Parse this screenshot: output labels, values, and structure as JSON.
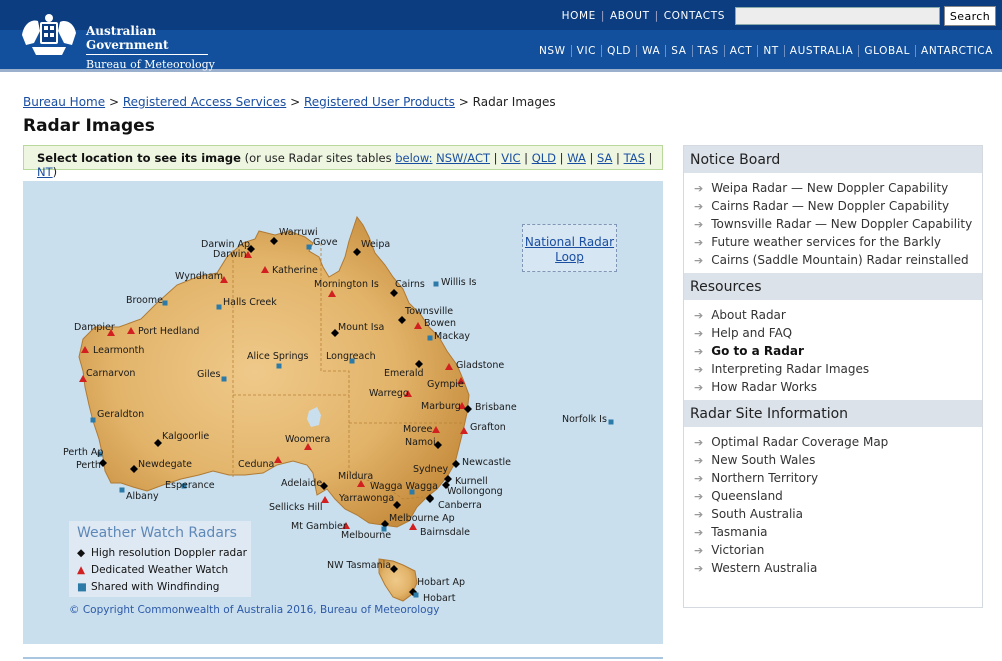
{
  "header": {
    "gov_line1": "Australian Government",
    "gov_line2": "Bureau of Meteorology",
    "top_links": [
      "HOME",
      "ABOUT",
      "CONTACTS"
    ],
    "search_placeholder": "",
    "search_button": "Search",
    "states": [
      "NSW",
      "VIC",
      "QLD",
      "WA",
      "SA",
      "TAS",
      "ACT",
      "NT",
      "AUSTRALIA",
      "GLOBAL",
      "ANTARCTICA"
    ]
  },
  "breadcrumb": {
    "items": [
      "Bureau Home",
      "Registered Access Services",
      "Registered User Products"
    ],
    "separator": ">",
    "current": "Radar Images"
  },
  "page_title": "Radar Images",
  "select_bar": {
    "bold": "Select location to see its image",
    "text": " (or use Radar sites tables ",
    "below": "below:",
    "links": [
      "NSW/ACT",
      "VIC",
      "QLD",
      "WA",
      "SA",
      "TAS",
      "NT"
    ],
    "end": ")"
  },
  "map": {
    "loop_link": "National Radar Loop",
    "legend": {
      "title": "Weather Watch Radars",
      "items": [
        "High resolution Doppler radar",
        "Dedicated Weather Watch",
        "Shared with Windfinding"
      ]
    },
    "copyright": "© Copyright Commonwealth of Australia 2016,",
    "copyright_link": "Bureau of Meteorology",
    "colors": {
      "sea": "#c9dfee",
      "land": "#e3b770",
      "doppler": "#000000",
      "weatherwatch": "#d21f1f",
      "windfinding": "#2b7aa8"
    },
    "sites": [
      {
        "name": "Warruwi",
        "type": "doppler"
      },
      {
        "name": "Gove",
        "type": "windfinding"
      },
      {
        "name": "Darwin Ap",
        "type": "doppler"
      },
      {
        "name": "Darwin",
        "type": "weatherwatch"
      },
      {
        "name": "Weipa",
        "type": "doppler"
      },
      {
        "name": "Katherine",
        "type": "weatherwatch"
      },
      {
        "name": "Wyndham",
        "type": "weatherwatch"
      },
      {
        "name": "Willis Is",
        "type": "windfinding"
      },
      {
        "name": "Mornington Is",
        "type": "weatherwatch"
      },
      {
        "name": "Cairns",
        "type": "doppler"
      },
      {
        "name": "Broome",
        "type": "windfinding"
      },
      {
        "name": "Halls Creek",
        "type": "windfinding"
      },
      {
        "name": "Townsville",
        "type": "doppler"
      },
      {
        "name": "Dampier",
        "type": "weatherwatch"
      },
      {
        "name": "Port Hedland",
        "type": "weatherwatch"
      },
      {
        "name": "Mount Isa",
        "type": "doppler"
      },
      {
        "name": "Bowen",
        "type": "weatherwatch"
      },
      {
        "name": "Mackay",
        "type": "windfinding"
      },
      {
        "name": "Learmonth",
        "type": "weatherwatch"
      },
      {
        "name": "Alice Springs",
        "type": "windfinding"
      },
      {
        "name": "Longreach",
        "type": "windfinding"
      },
      {
        "name": "Gladstone",
        "type": "weatherwatch"
      },
      {
        "name": "Emerald",
        "type": "doppler"
      },
      {
        "name": "Carnarvon",
        "type": "weatherwatch"
      },
      {
        "name": "Giles",
        "type": "windfinding"
      },
      {
        "name": "Gympie",
        "type": "weatherwatch"
      },
      {
        "name": "Warrego",
        "type": "weatherwatch"
      },
      {
        "name": "Marburg",
        "type": "weatherwatch"
      },
      {
        "name": "Brisbane",
        "type": "doppler"
      },
      {
        "name": "Geraldton",
        "type": "windfinding"
      },
      {
        "name": "Norfolk Is",
        "type": "windfinding"
      },
      {
        "name": "Moree",
        "type": "weatherwatch"
      },
      {
        "name": "Grafton",
        "type": "weatherwatch"
      },
      {
        "name": "Kalgoorlie",
        "type": "doppler"
      },
      {
        "name": "Woomera",
        "type": "weatherwatch"
      },
      {
        "name": "Namoi",
        "type": "doppler"
      },
      {
        "name": "Perth Ap",
        "type": "windfinding"
      },
      {
        "name": "Perth",
        "type": "doppler"
      },
      {
        "name": "Newdegate",
        "type": "doppler"
      },
      {
        "name": "Ceduna",
        "type": "weatherwatch"
      },
      {
        "name": "Newcastle",
        "type": "doppler"
      },
      {
        "name": "Sydney",
        "type": "doppler"
      },
      {
        "name": "Kurnell",
        "type": "doppler"
      },
      {
        "name": "Mildura",
        "type": "weatherwatch"
      },
      {
        "name": "Adelaide",
        "type": "doppler"
      },
      {
        "name": "Wagga Wagga",
        "type": "windfinding"
      },
      {
        "name": "Wollongong",
        "type": "doppler"
      },
      {
        "name": "Esperance",
        "type": "windfinding"
      },
      {
        "name": "Albany",
        "type": "windfinding"
      },
      {
        "name": "Sellicks Hill",
        "type": "weatherwatch"
      },
      {
        "name": "Yarrawonga",
        "type": "doppler"
      },
      {
        "name": "Canberra",
        "type": "doppler"
      },
      {
        "name": "Mt Gambier",
        "type": "weatherwatch"
      },
      {
        "name": "Melbourne Ap",
        "type": "doppler"
      },
      {
        "name": "Melbourne",
        "type": "windfinding"
      },
      {
        "name": "Bairnsdale",
        "type": "weatherwatch"
      },
      {
        "name": "NW Tasmania",
        "type": "doppler"
      },
      {
        "name": "Hobart Ap",
        "type": "doppler"
      },
      {
        "name": "Hobart",
        "type": "windfinding"
      }
    ]
  },
  "sidebar": {
    "notice": {
      "title": "Notice Board",
      "items": [
        "Weipa Radar — New Doppler Capability",
        "Cairns Radar — New Doppler Capability",
        "Townsville Radar — New Doppler Capability",
        "Future weather services for the Barkly",
        "Cairns (Saddle Mountain) Radar reinstalled"
      ]
    },
    "resources": {
      "title": "Resources",
      "items": [
        "About Radar",
        "Help and FAQ",
        "Go to a Radar",
        "Interpreting Radar Images",
        "How Radar Works"
      ]
    },
    "siteinfo": {
      "title": "Radar Site Information",
      "items": [
        "Optimal Radar Coverage Map",
        "New South Wales",
        "Northern Territory",
        "Queensland",
        "South Australia",
        "Tasmania",
        "Victorian",
        "Western Australia"
      ]
    }
  }
}
